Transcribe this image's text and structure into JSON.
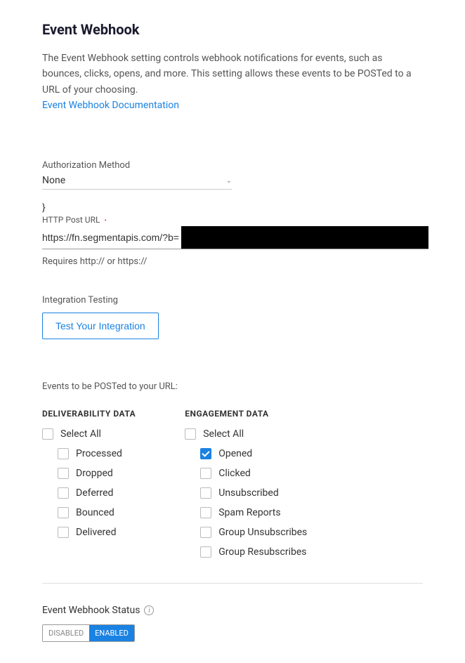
{
  "header": {
    "title": "Event Webhook",
    "description": "The Event Webhook setting controls webhook notifications for events, such as bounces, clicks, opens, and more. This setting allows these events to be POSTed to a URL of your choosing.",
    "doc_link": "Event Webhook Documentation"
  },
  "auth": {
    "label": "Authorization Method",
    "value": "None"
  },
  "brace": "}",
  "url": {
    "label": "HTTP Post URL",
    "value": "https://fn.segmentapis.com/?b=",
    "helper": "Requires http:// or https://"
  },
  "integration": {
    "label": "Integration Testing",
    "button": "Test Your Integration"
  },
  "events": {
    "intro": "Events to be POSTed to your URL:",
    "deliverability": {
      "header": "DELIVERABILITY DATA",
      "select_all": "Select All",
      "items": [
        {
          "label": "Processed",
          "checked": false
        },
        {
          "label": "Dropped",
          "checked": false
        },
        {
          "label": "Deferred",
          "checked": false
        },
        {
          "label": "Bounced",
          "checked": false
        },
        {
          "label": "Delivered",
          "checked": false
        }
      ]
    },
    "engagement": {
      "header": "ENGAGEMENT DATA",
      "select_all": "Select All",
      "items": [
        {
          "label": "Opened",
          "checked": true
        },
        {
          "label": "Clicked",
          "checked": false
        },
        {
          "label": "Unsubscribed",
          "checked": false
        },
        {
          "label": "Spam Reports",
          "checked": false
        },
        {
          "label": "Group Unsubscribes",
          "checked": false
        },
        {
          "label": "Group Resubscribes",
          "checked": false
        }
      ]
    }
  },
  "status": {
    "label": "Event Webhook Status",
    "disabled": "DISABLED",
    "enabled": "ENABLED",
    "active": "enabled"
  }
}
